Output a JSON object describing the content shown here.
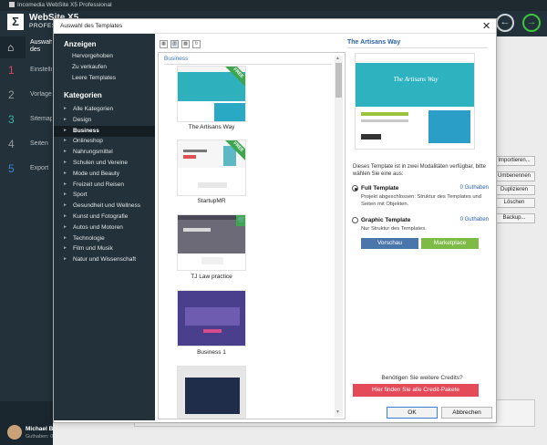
{
  "app": {
    "title": "Incomedia WebSite X5 Professional",
    "name": "WebSite X5",
    "edition": "PROFESSIONAL",
    "back_icon": "arrow-left-icon",
    "forward_icon": "arrow-right-icon"
  },
  "rail": {
    "home_label": "Auswahl des Projekts",
    "steps": [
      {
        "num": "1",
        "label": "Einstellungen"
      },
      {
        "num": "2",
        "label": "Vorlage"
      },
      {
        "num": "3",
        "label": "Sitemap"
      },
      {
        "num": "4",
        "label": "Seiten"
      },
      {
        "num": "5",
        "label": "Export"
      }
    ],
    "step_colors": [
      "#e0445a",
      "#9b9b9b",
      "#36b7a9",
      "#9b9b9b",
      "#3b84d6"
    ],
    "user": {
      "name": "Michael B.",
      "credits": "Guthaben: 0"
    }
  },
  "background": {
    "buttons": [
      "Importieren...",
      "Umbenennen",
      "Duplizieren",
      "Löschen",
      "Backup..."
    ]
  },
  "dialog": {
    "title": "Auswahl des Templates",
    "sidebar": {
      "show_heading": "Anzeigen",
      "show_links": [
        "Hervorgehoben",
        "Zu verkaufen",
        "Leere Templates"
      ],
      "categories_heading": "Kategorien",
      "categories": [
        "Alle Kategorien",
        "Design",
        "Business",
        "Onlineshop",
        "Nahrungsmittel",
        "Schulen und Vereine",
        "Mode und Beauty",
        "Freizeit und Reisen",
        "Sport",
        "Gesundheit und Wellness",
        "Kunst und Fotografie",
        "Autos und Motoren",
        "Technologie",
        "Film und Musik",
        "Natur und Wissenschaft"
      ],
      "active_category": "Business"
    },
    "list": {
      "section_label": "Business",
      "templates": [
        {
          "name": "The Artisans Way",
          "badge": "FREE"
        },
        {
          "name": "StartupMR",
          "badge": "FREE"
        },
        {
          "name": "TJ Law practice",
          "badge": "cart"
        },
        {
          "name": "Business 1",
          "badge": ""
        },
        {
          "name": "",
          "badge": ""
        }
      ]
    },
    "preview": {
      "title": "The Artisans Way",
      "image_heading": "The Artisans Way",
      "description": "Dieses Template ist in zwei Modalitäten verfügbar, bitte wählen Sie eine aus:",
      "options": [
        {
          "title": "Full Template",
          "credits": "0 Guthaben",
          "desc": "Projekt abgeschlossen: Struktur des Templates und Seiten mit Objekten.",
          "selected": true
        },
        {
          "title": "Graphic Template",
          "credits": "0 Guthaben",
          "desc": "Nur Struktur des Templates.",
          "selected": false
        }
      ],
      "preview_button": "Vorschau",
      "marketplace_button": "Marketplace",
      "need_credits": "Benötigen Sie weitere Credits?",
      "credits_button": "Hier finden Sie alle Credit-Pakete"
    },
    "ok_button": "OK",
    "cancel_button": "Abbrechen"
  }
}
